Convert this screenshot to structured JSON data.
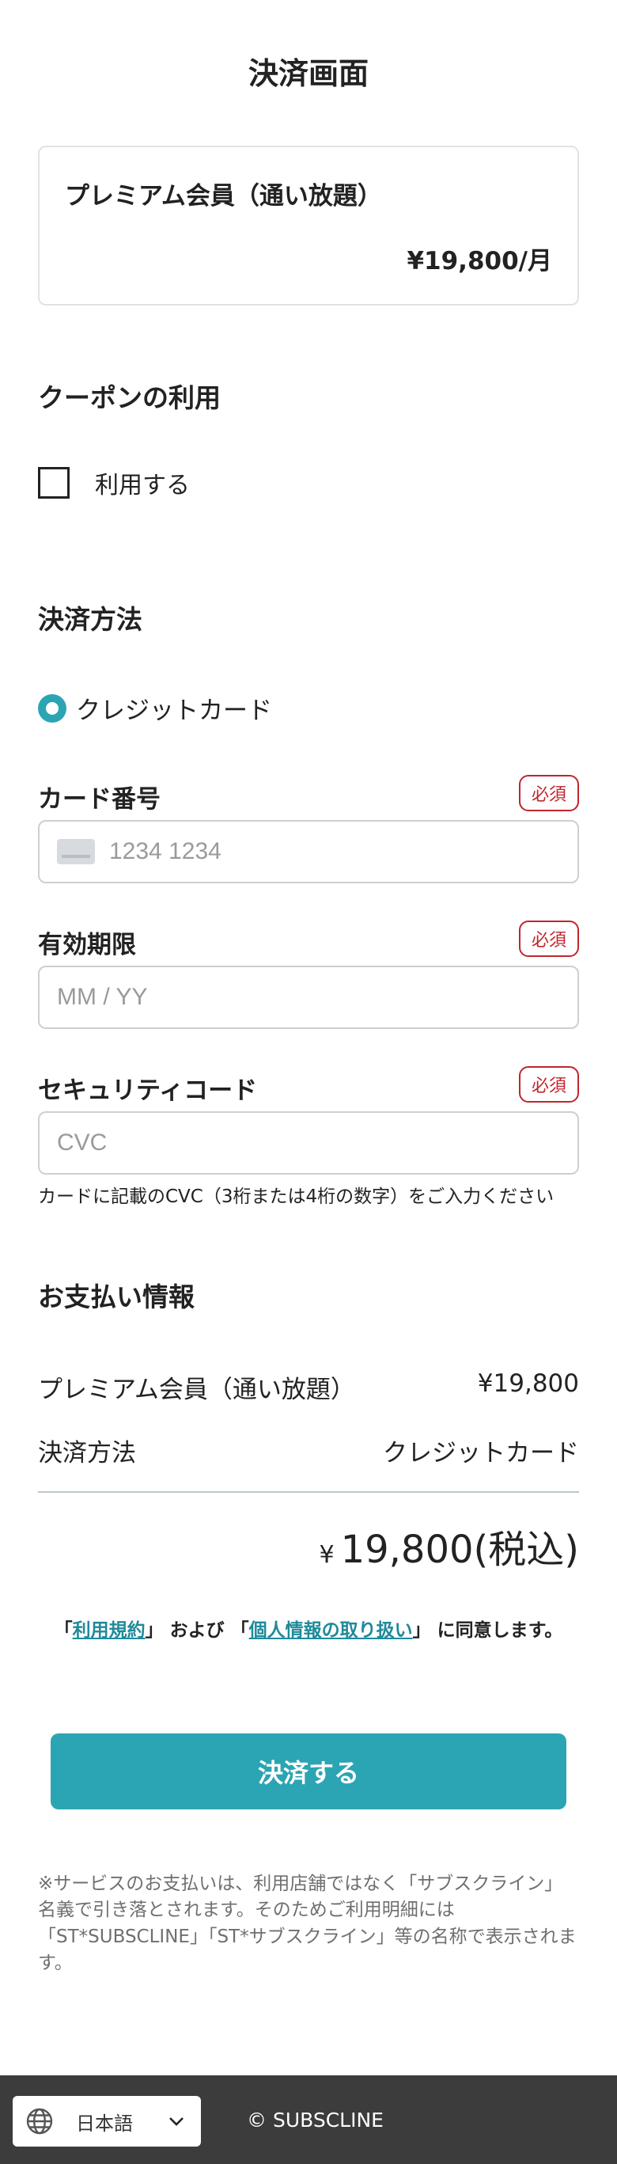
{
  "page": {
    "title": "決済画面"
  },
  "plan": {
    "name": "プレミアム会員（通い放題）",
    "price": "¥19,800/月"
  },
  "coupon": {
    "section_title": "クーポンの利用",
    "checkbox_label": "利用する"
  },
  "payment_method": {
    "section_title": "決済方法",
    "option_label": "クレジットカード"
  },
  "form": {
    "card_number": {
      "label": "カード番号",
      "required": "必須",
      "placeholder": "1234 1234"
    },
    "expiry": {
      "label": "有効期限",
      "required": "必須",
      "placeholder": "MM / YY"
    },
    "security_code": {
      "label": "セキュリティコード",
      "required": "必須",
      "placeholder": "CVC",
      "hint": "カードに記載のCVC（3桁または4桁の数字）をご入力ください"
    }
  },
  "summary": {
    "section_title": "お支払い情報",
    "rows": [
      {
        "label": "プレミアム会員（通い放題）",
        "value": "¥19,800"
      },
      {
        "label": "決済方法",
        "value": "クレジットカード"
      }
    ],
    "total_currency": "¥",
    "total_amount": "19,800(税込)"
  },
  "agreement": {
    "open1": "「",
    "terms_link": "利用規約",
    "mid": "」 および 「",
    "privacy_link": "個人情報の取り扱い",
    "close": "」 に同意します。"
  },
  "pay_button": {
    "label": "決済する"
  },
  "notice": "※サービスのお支払いは、利用店舗ではなく「サブスクライン」名義で引き落とされます。そのためご利用明細には「ST*SUBSCLINE」「ST*サブスクライン」等の名称で表示されます。",
  "footer": {
    "language": "日本語",
    "copyright": "© SUBSCLINE"
  },
  "colors": {
    "accent": "#2ba5b3",
    "required": "#c0262d",
    "footer_bg": "#3c3c3c"
  }
}
